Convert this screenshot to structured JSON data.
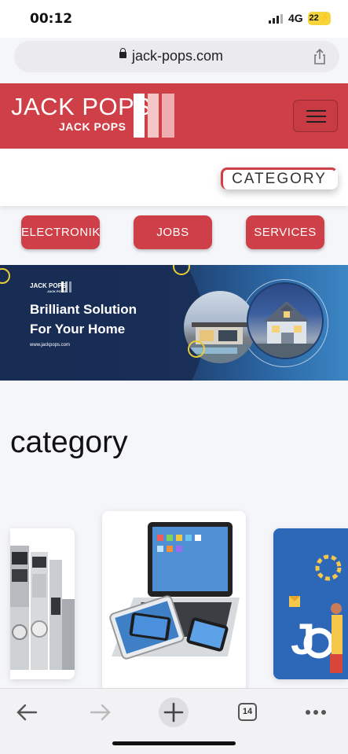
{
  "status_bar": {
    "time": "00:12",
    "network": "4G",
    "battery": "22"
  },
  "browser": {
    "url": "jack-pops.com",
    "tab_count": "14"
  },
  "header": {
    "logo_main": "JACK POPS",
    "logo_sub": "JACK POPS",
    "brand_color": "#cf3f47"
  },
  "category_button": "CATEGORY",
  "nav_pills": [
    "ELECTRONIK",
    "JOBS",
    "SERVICES"
  ],
  "banner": {
    "brand": "JACK POPS",
    "brand_sub": "JACK POPS",
    "title_line1": "Brilliant Solution",
    "title_line2": "For Your Home",
    "website": "www.jackpops.com"
  },
  "section_title": "category",
  "cards": [
    {
      "name": "appliances-card",
      "icon": "appliances"
    },
    {
      "name": "electronics-card",
      "icon": "laptop-tablet-phones"
    },
    {
      "name": "jobs-card",
      "icon": "jobs-illustration",
      "text": "J"
    }
  ],
  "toolbar": {
    "icons": [
      "back-arrow-icon",
      "forward-arrow-icon",
      "new-tab-icon",
      "tabs-icon",
      "more-icon"
    ]
  }
}
